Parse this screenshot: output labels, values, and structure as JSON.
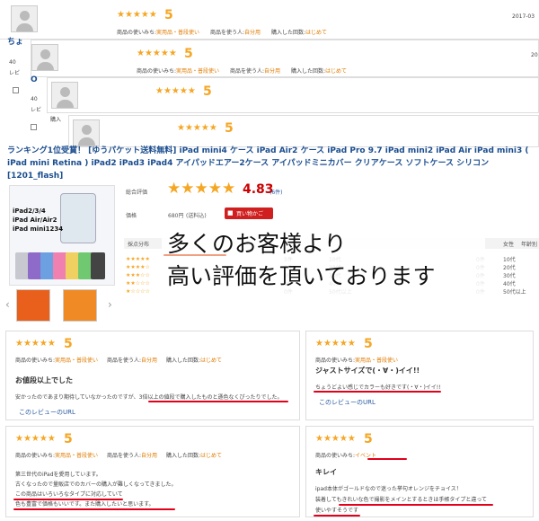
{
  "stack": {
    "stars": "★★★★★",
    "score": "5",
    "date": "2017-03",
    "date2": "20",
    "usage_label": "商品の使いみち:",
    "usage_value": "実用品・普段使い",
    "user_label": "商品を使う人:",
    "user_value": "自分用",
    "count_label": "購入した回数:",
    "count_value": "はじめて",
    "frag1": "ちょ",
    "frag2": "40",
    "frag3": "レビ",
    "frag4": "O",
    "frag5": "40",
    "frag6": "レビ",
    "frag7": "購入",
    "frag8": "商品",
    "frag9": "40"
  },
  "product": {
    "title": "ランキング1位受賞！ [ゆうパケット送料無料] iPad mini4 ケース iPad Air2 ケース iPad Pro 9.7 iPad mini2 iPad Air iPad mini3 ( iPad mini Retina ) iPad2 iPad3 iPad4 アイパッドエアー2ケース アイパッドミニカバー クリアケース ソフトケース シリコン [1201_flash]",
    "image_text": [
      "iPad2/3/4",
      "iPad Air/Air2",
      "iPad mini1234"
    ],
    "rating_label": "総合評価",
    "rating_stars": "★★★★★",
    "rating_value": "4.83",
    "rating_count": "(6件)",
    "price_label": "価格",
    "price": "680円",
    "shipping": "(送料込)",
    "buy_button": "買い物かご",
    "dist_label": "採点分布",
    "dist_counts": [
      "5件",
      "1件",
      "0件",
      "0件",
      "0件"
    ],
    "age_header_gender": "女性",
    "age_header": "年齢別",
    "ages": [
      "10代",
      "20代",
      "30代",
      "40代",
      "50代以上"
    ],
    "age_counts": [
      "0件",
      "0件",
      "0件",
      "0件",
      "0件"
    ],
    "age_extra": "50代以上"
  },
  "overlay": {
    "line1": "多くのお客様より",
    "line2": "高い評価を頂いております"
  },
  "reviews": [
    {
      "stars": "★★★★★",
      "score": "5",
      "usage_label": "商品の使いみち:",
      "usage_value": "実用品・普段使い",
      "user_label": "商品を使う人:",
      "user_value": "自分用",
      "count_label": "購入した回数:",
      "count_value": "はじめて",
      "title": "お値段以上でした",
      "body": [
        "安かったのであまり期待していなかったのですが、3倍以上の値段で購入したものと遜色なくぴったりでした。"
      ],
      "link": "このレビューのURL"
    },
    {
      "stars": "★★★★★",
      "score": "5",
      "usage_label": "商品の使いみち:",
      "usage_value": "実用品・普段使い",
      "user_label": "",
      "user_value": "",
      "count_label": "",
      "count_value": "",
      "title": "ジャストサイズで(・∀・)イイ!!",
      "body": [
        "ちょうどよい感じでカラーも好きです(・∀・)イイ!!"
      ],
      "link": "このレビューのURL"
    },
    {
      "stars": "★★★★★",
      "score": "5",
      "usage_label": "商品の使いみち:",
      "usage_value": "実用品・普段使い",
      "user_label": "商品を使う人:",
      "user_value": "自分用",
      "count_label": "購入した回数:",
      "count_value": "はじめて",
      "title": "",
      "body": [
        "第三世代のiPadを愛用しています。",
        "古くなったので量販店でのカバーの購入が難しくなってきました。",
        "この商品はいろいろなタイプに対応していて",
        "色も豊富で価格もいいです。また購入したいと思います。"
      ],
      "link": ""
    },
    {
      "stars": "★★★★★",
      "score": "5",
      "usage_label": "商品の使いみち:",
      "usage_value": "イベント",
      "user_label": "",
      "user_value": "",
      "count_label": "",
      "count_value": "",
      "title": "キレイ",
      "body": [
        "ipad本体がゴールドなので迷った挙句オレンジをチョイス！",
        "装着してもきれいな色で撮影をメインとするときは手帳タイプと違って",
        "使いやすそうです"
      ],
      "link": ""
    }
  ]
}
